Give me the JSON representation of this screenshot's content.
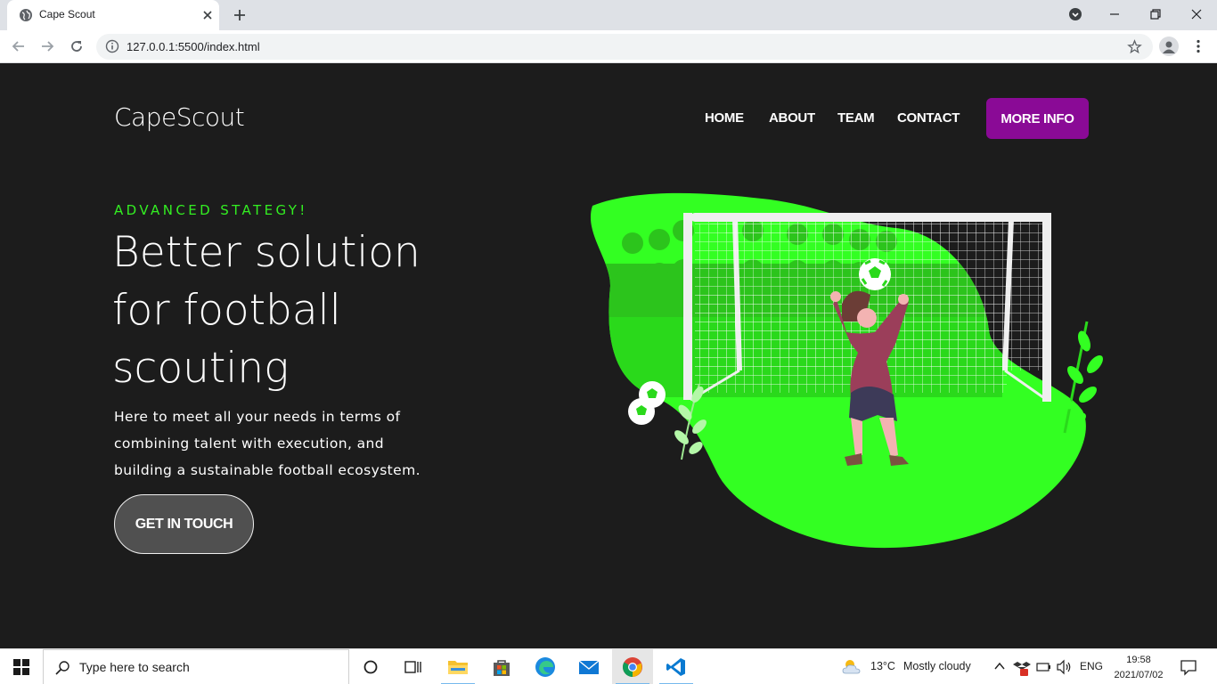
{
  "browser": {
    "tab_title": "Cape Scout",
    "url": "127.0.0.1:5500/index.html"
  },
  "site": {
    "logo": "CapeScout",
    "nav": [
      "HOME",
      "ABOUT",
      "TEAM",
      "CONTACT"
    ],
    "cta_nav": "MORE INFO",
    "eyebrow": "ADVANCED STATEGY!",
    "headline": [
      "Better solution",
      "for football",
      "scouting"
    ],
    "lead": [
      "Here to meet all your needs in terms of",
      "combining talent with execution, and",
      "building a sustainable football ecosystem."
    ],
    "cta": "GET IN TOUCH",
    "colors": {
      "background": "#1c1c1c",
      "accent_green": "#33ff22",
      "accent_purple": "#8a0a96"
    },
    "illustration": "goalkeeper-saving-ball-illustration"
  },
  "taskbar": {
    "search_placeholder": "Type here to search",
    "apps": [
      "task-view",
      "file-explorer",
      "microsoft-store",
      "edge",
      "mail",
      "chrome",
      "vscode"
    ],
    "weather": {
      "temp": "13°C",
      "condition": "Mostly cloudy"
    },
    "language": "ENG",
    "time": "19:58",
    "date": "2021/07/02"
  }
}
